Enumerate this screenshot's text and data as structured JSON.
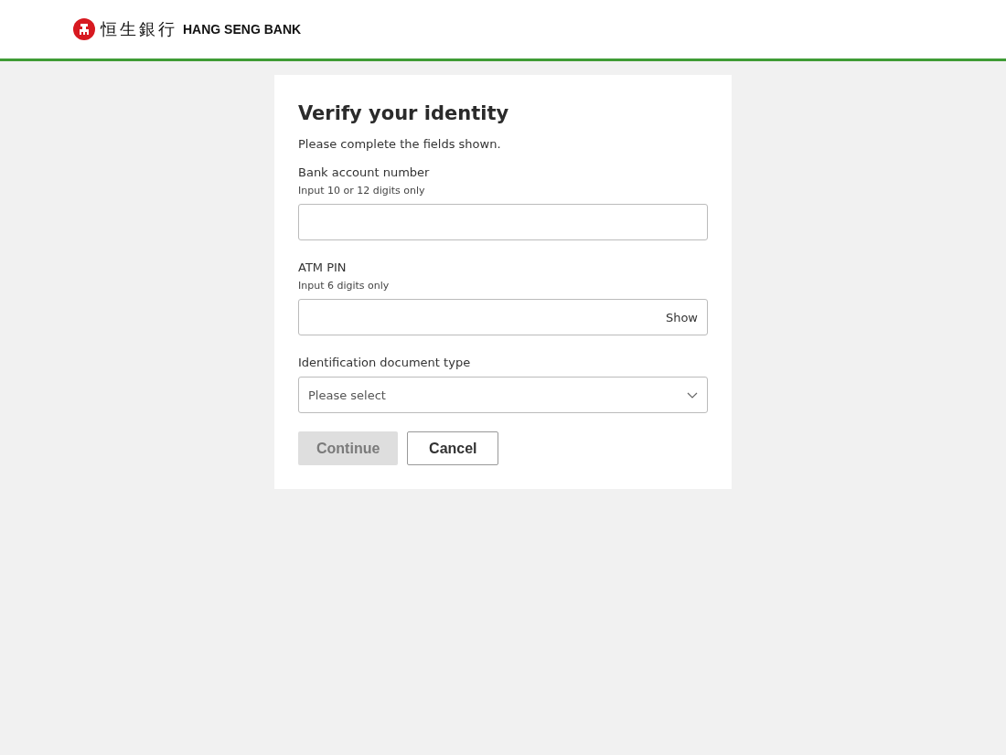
{
  "header": {
    "logo_chinese": "恒生銀行",
    "logo_english": "HANG SENG BANK"
  },
  "card": {
    "title": "Verify your identity",
    "intro": "Please complete the fields shown.",
    "fields": [
      {
        "kind": "text",
        "label": "Bank account number",
        "hint": "Input 10 or 12 digits only"
      },
      {
        "kind": "password",
        "label": "ATM PIN",
        "hint": "Input 6 digits only",
        "toggle": "Show"
      },
      {
        "kind": "select",
        "label": "Identification document type",
        "placeholder": "Please select"
      }
    ],
    "buttons": [
      {
        "label": "Continue",
        "kind": "primary",
        "disabled": true
      },
      {
        "label": "Cancel",
        "kind": "secondary",
        "disabled": false
      }
    ]
  }
}
